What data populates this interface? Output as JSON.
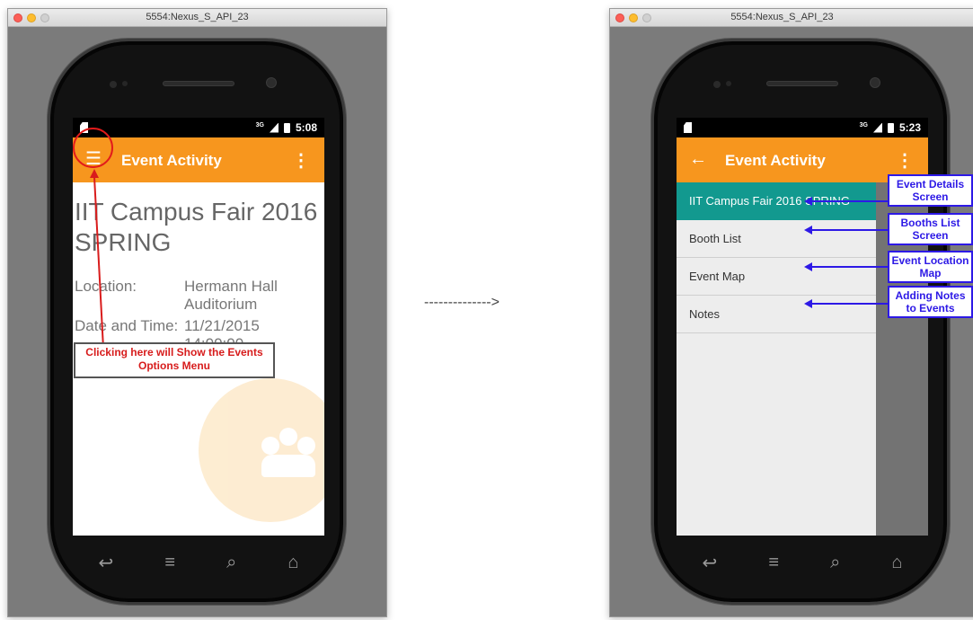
{
  "left_window": {
    "title": "5554:Nexus_S_API_23",
    "status_time": "5:08",
    "network": "3G",
    "toolbar_title": "Event Activity",
    "event_name": "IIT Campus Fair 2016 SPRING",
    "location_label": "Location:",
    "location_value": "Hermann Hall Auditorium",
    "datetime_label": "Date and Time:",
    "datetime_value": "11/21/2015 14:00:00",
    "annotation": "Clicking here will Show the Events Options Menu"
  },
  "arrow_text": "-------------->",
  "right_window": {
    "title": "5554:Nexus_S_API_23",
    "status_time": "5:23",
    "network": "3G",
    "toolbar_title": "Event Activity",
    "drawer_items": [
      {
        "label": "IIT Campus Fair 2016 SPRING",
        "callout": "Event Details Screen"
      },
      {
        "label": "Booth List",
        "callout": "Booths List Screen"
      },
      {
        "label": "Event Map",
        "callout": "Event Location Map"
      },
      {
        "label": "Notes",
        "callout": "Adding Notes to Events"
      }
    ]
  },
  "icons": {
    "menu": "hamburger-icon",
    "back": "back-arrow-icon",
    "more": "overflow-menu-icon",
    "nav_back": "back-icon",
    "nav_menu": "menu-icon",
    "nav_search": "search-icon",
    "nav_home": "home-icon"
  },
  "colors": {
    "toolbar": "#f7961e",
    "drawer_active": "#12998f",
    "callout_blue": "#2d19e6",
    "annotation_red": "#d71c1c"
  }
}
